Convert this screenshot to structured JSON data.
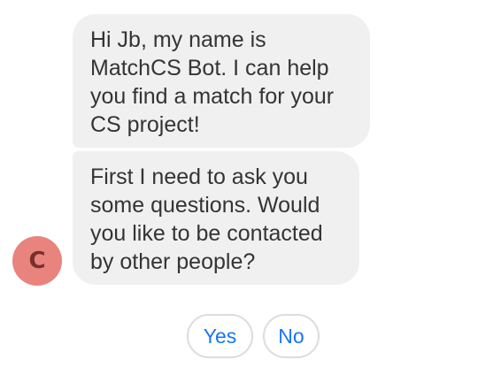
{
  "conversation": {
    "messages": [
      {
        "sender": "bot",
        "text": "Hi Jb, my name is MatchCS Bot. I can help you find a match for your CS project!"
      },
      {
        "sender": "bot",
        "text": "First I need to ask you some questions. Would you like to be contacted by other people?"
      }
    ],
    "avatar": {
      "initial": "C",
      "color": "#e8847d"
    }
  },
  "quick_replies": [
    {
      "label": "Yes"
    },
    {
      "label": "No"
    }
  ],
  "colors": {
    "bubble_background": "#f0f0f0",
    "reply_text": "#1877f2",
    "reply_border": "#dcdcdc"
  }
}
